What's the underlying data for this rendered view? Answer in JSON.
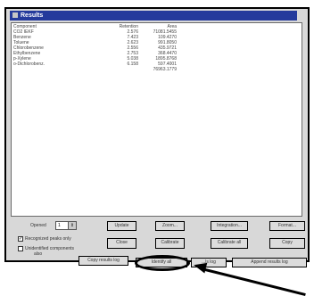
{
  "window": {
    "title": "Results"
  },
  "columns": [
    "Component",
    "Retention",
    "Area"
  ],
  "rows": [
    [
      "CO2 IEKF",
      "2.576",
      "71081.5455"
    ],
    [
      "Benzene",
      "7.423",
      "109.4270"
    ],
    [
      "Toluene",
      "2.623",
      "991.8050"
    ],
    [
      "Chlorobenzene",
      "2.556",
      "435.9721"
    ],
    [
      "Ethylbenzene",
      "2.753",
      "368.4470"
    ],
    [
      "p-Xylene",
      "5.038",
      "1895.8768"
    ],
    [
      "o-Dichlorobenz.",
      "6.158",
      "597.4001"
    ],
    [
      "",
      "",
      "76963.1779"
    ]
  ],
  "controls": {
    "opened_label": "Opened",
    "opened_value": "1",
    "checkbox1": "Recognized peaks only",
    "checkbox2": "Unidentified components",
    "checkbox2_cont": "also",
    "update": "Update",
    "zoom": "Zoom...",
    "integration": "Integration...",
    "format": "Format...",
    "close": "Close",
    "calibrate": "Calibrate",
    "calibrate_all": "Calibrate all",
    "copy": "Copy",
    "copy_results": "Copy results log",
    "highlight": "Identify all",
    "partial": "...ls log",
    "append_results": "Append results log"
  }
}
